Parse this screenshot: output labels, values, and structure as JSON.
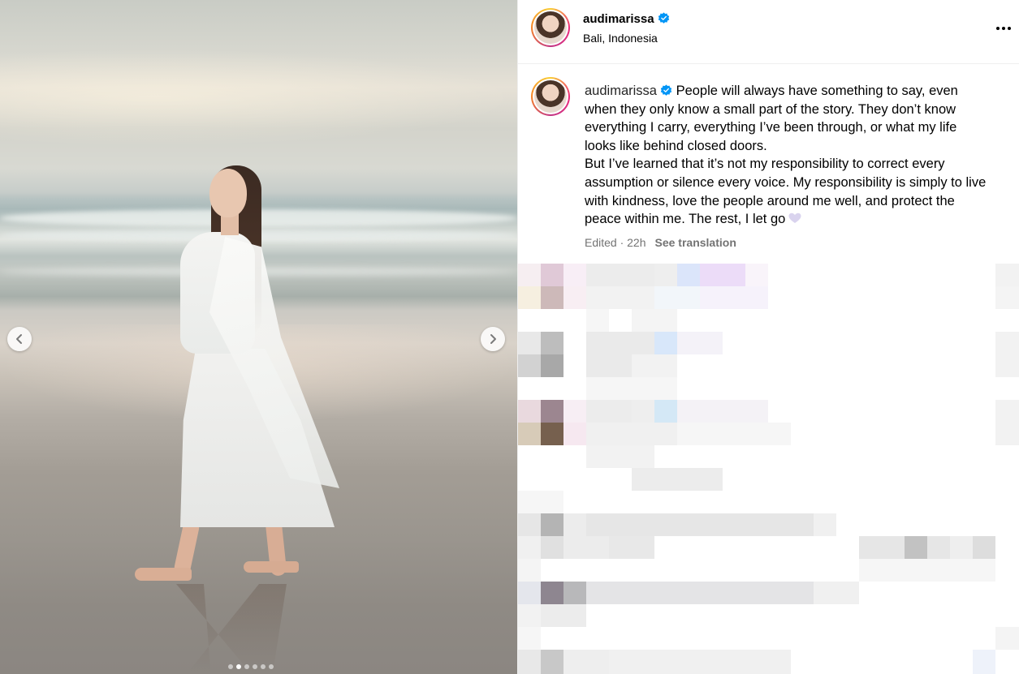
{
  "post": {
    "username": "audimarissa",
    "location": "Bali, Indonesia",
    "caption_user": "audimarissa",
    "caption_line1": "People will always have something to say, even when they only know a small part of the story. They don’t know everything I carry, everything I’ve been through, or what my life looks like behind closed doors.",
    "caption_line2": "But I’ve learned that it’s not my responsibility to correct every assumption or silence every voice. My responsibility is simply to live with kindness, love the people around me well, and protect the peace within me. The rest, I let go",
    "edited_label": "Edited · 22h",
    "see_translation": "See translation"
  },
  "carousel": {
    "slide_count": 6,
    "active_slide": 2
  },
  "icons": {
    "verified": "verified-badge-icon",
    "more": "more-options-icon",
    "prev": "chevron-left-icon",
    "next": "chevron-right-icon",
    "heart": "light-purple-heart-icon"
  },
  "colors": {
    "verified_blue": "#0095f6",
    "muted_text": "#737373",
    "heart": "#d9d3ee"
  }
}
